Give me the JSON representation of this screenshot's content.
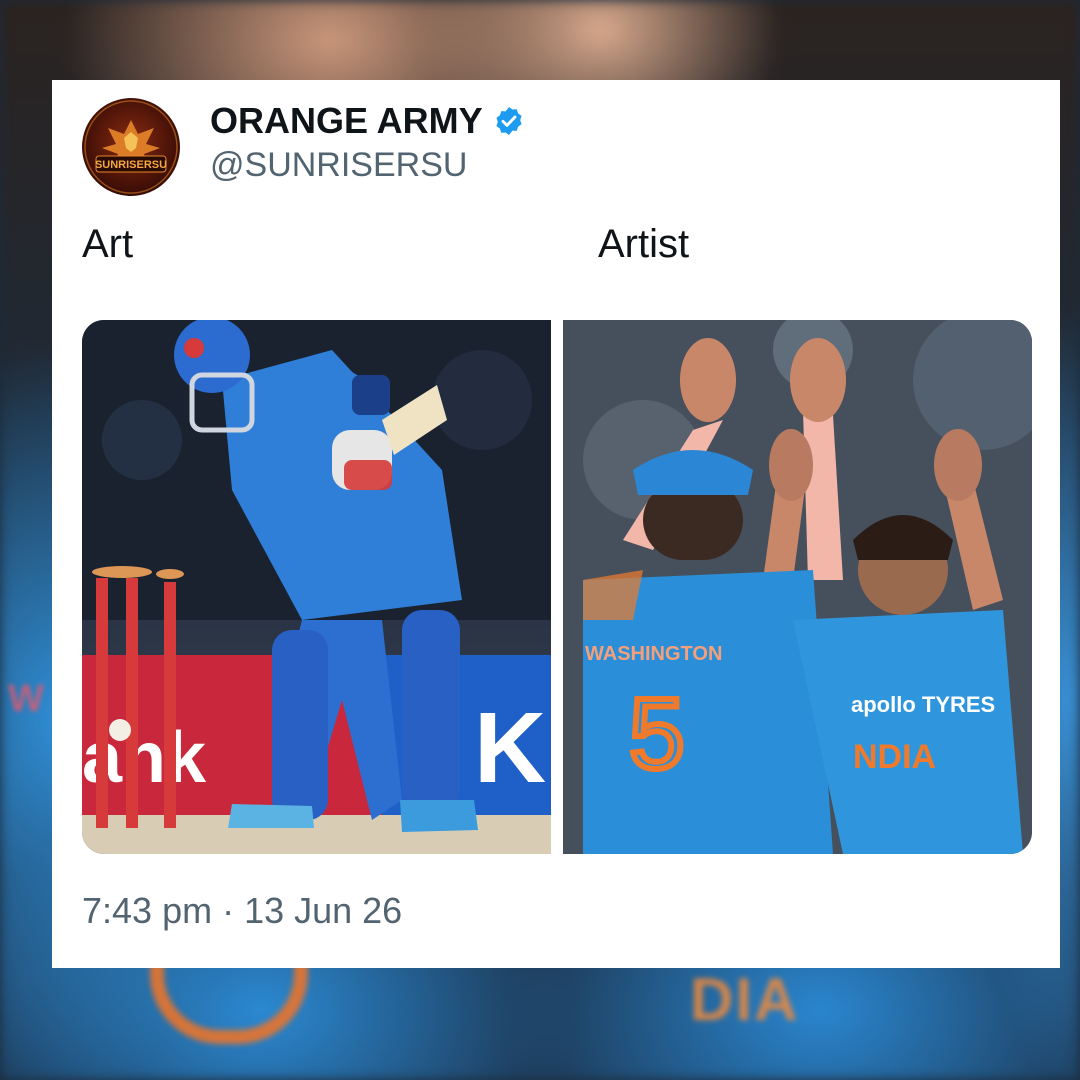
{
  "account": {
    "display_name": "ORANGE ARMY",
    "handle": "@SUNRISERSU",
    "avatar_text": "SUNRISERSU",
    "verified": true
  },
  "post": {
    "caption_left": "Art",
    "caption_right": "Artist",
    "timestamp": "7:43 pm · 13 Jun 26"
  },
  "photos": {
    "left": {
      "icon": "batsman-bowled-photo",
      "banner_text": "ank",
      "banner_text_right": "K"
    },
    "right": {
      "icon": "players-high-five-photo",
      "jersey_name": "WASHINGTON",
      "jersey_number": "5",
      "sponsor_text": "apollo TYRES",
      "team_text": "NDIA"
    }
  },
  "colors": {
    "verified_blue": "#1d9bf0",
    "text_primary": "#0f1419",
    "text_secondary": "#536471",
    "jersey_blue": "#2a8fd8",
    "jersey_orange": "#f07a2c"
  }
}
